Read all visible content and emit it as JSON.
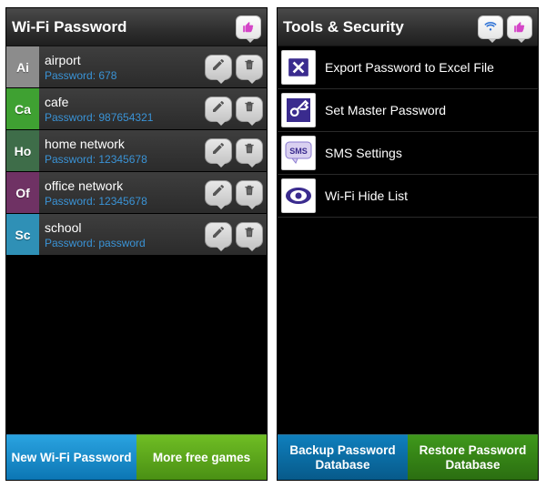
{
  "left": {
    "title": "Wi-Fi Password",
    "entries": [
      {
        "badge": "Ai",
        "badge_class": "c-ai",
        "name": "airport",
        "password_label": "Password: 678"
      },
      {
        "badge": "Ca",
        "badge_class": "c-ca",
        "name": "cafe",
        "password_label": "Password: 987654321"
      },
      {
        "badge": "Ho",
        "badge_class": "c-ho",
        "name": "home network",
        "password_label": "Password: 12345678"
      },
      {
        "badge": "Of",
        "badge_class": "c-of",
        "name": "office network",
        "password_label": "Password: 12345678"
      },
      {
        "badge": "Sc",
        "badge_class": "c-sc",
        "name": "school",
        "password_label": "Password: password"
      }
    ],
    "buttons": {
      "new": "New Wi-Fi Password",
      "games": "More free games"
    }
  },
  "right": {
    "title": "Tools & Security",
    "tools": [
      {
        "icon": "excel-icon",
        "label": "Export Password to Excel File"
      },
      {
        "icon": "key-icon",
        "label": "Set Master Password"
      },
      {
        "icon": "sms-icon",
        "label": "SMS Settings"
      },
      {
        "icon": "eye-icon",
        "label": "Wi-Fi Hide List"
      }
    ],
    "buttons": {
      "backup": "Backup Password Database",
      "restore": "Restore Password Database"
    }
  }
}
